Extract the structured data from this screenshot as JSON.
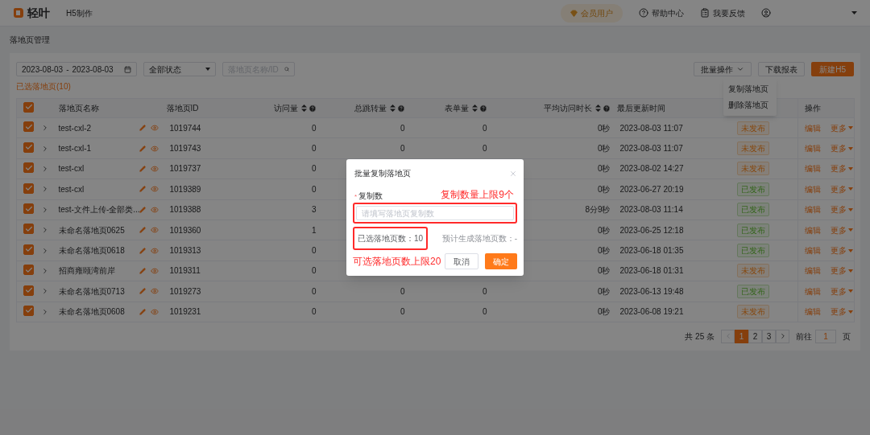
{
  "header": {
    "logo_text": "轻叶",
    "product": "H5制作",
    "member": "会员用户",
    "links": [
      {
        "kind": "help",
        "label": "帮助中心"
      },
      {
        "kind": "feedback",
        "label": "我要反馈"
      }
    ]
  },
  "breadcrumb": "落地页管理",
  "filters": {
    "date_start": "2023-08-03",
    "date_sep": "-",
    "date_end": "2023-08-03",
    "status": "全部状态",
    "search_placeholder": "落地页名称/ID"
  },
  "selected_text": "已选落地页(10)",
  "toolbar": {
    "batch": "批量操作",
    "download": "下载报表",
    "create": "新建H5",
    "batch_menu": [
      {
        "label": "复制落地页"
      },
      {
        "label": "删除落地页"
      }
    ]
  },
  "table": {
    "all_checked": true,
    "columns": [
      {
        "label": "落地页名称",
        "sortable": false,
        "help": false
      },
      {
        "label": "落地页ID",
        "sortable": false,
        "help": false
      },
      {
        "label": "访问量",
        "sortable": true,
        "help": true
      },
      {
        "label": "总跳转量",
        "sortable": true,
        "help": true
      },
      {
        "label": "表单量",
        "sortable": true,
        "help": true
      },
      {
        "label": "平均访问时长",
        "sortable": true,
        "help": true
      },
      {
        "label": "最后更新时间",
        "sortable": false,
        "help": false
      },
      {
        "label": "操作",
        "sortable": false,
        "help": false
      }
    ],
    "rows": [
      {
        "checked": true,
        "name": "test-cxl-2",
        "id": "1019744",
        "visits": "0",
        "jumps": "0",
        "forms": "0",
        "avg": "0秒",
        "updated": "2023-08-03 11:07",
        "status": "未发布",
        "published": false,
        "edit": "编辑",
        "more": "更多"
      },
      {
        "checked": true,
        "name": "test-cxl-1",
        "id": "1019743",
        "visits": "0",
        "jumps": "0",
        "forms": "0",
        "avg": "0秒",
        "updated": "2023-08-03 11:07",
        "status": "未发布",
        "published": false,
        "edit": "编辑",
        "more": "更多"
      },
      {
        "checked": true,
        "name": "test-cxl",
        "id": "1019737",
        "visits": "0",
        "avg": "0秒",
        "updated": "2023-08-02 14:27",
        "status": "未发布",
        "published": false,
        "edit": "编辑",
        "more": "更多"
      },
      {
        "checked": true,
        "name": "test-cxl",
        "id": "1019389",
        "visits": "0",
        "avg": "0秒",
        "updated": "2023-06-27 20:19",
        "status": "已发布",
        "published": true,
        "edit": "编辑",
        "more": "更多"
      },
      {
        "checked": true,
        "name": "test-文件上传-全部类...",
        "id": "1019388",
        "visits": "3",
        "avg": "8分9秒",
        "updated": "2023-08-03 11:14",
        "status": "已发布",
        "published": true,
        "edit": "编辑",
        "more": "更多"
      },
      {
        "checked": true,
        "name": "未命名落地页0625",
        "id": "1019360",
        "visits": "1",
        "avg": "0秒",
        "updated": "2023-06-25 12:18",
        "status": "已发布",
        "published": true,
        "edit": "编辑",
        "more": "更多"
      },
      {
        "checked": true,
        "name": "未命名落地页0618",
        "id": "1019313",
        "visits": "0",
        "avg": "0秒",
        "updated": "2023-06-18 01:35",
        "status": "已发布",
        "published": true,
        "edit": "编辑",
        "more": "更多"
      },
      {
        "checked": true,
        "name": "招商雍颐湾前岸",
        "id": "1019311",
        "visits": "0",
        "avg": "0秒",
        "updated": "2023-06-18 01:31",
        "status": "未发布",
        "published": false,
        "edit": "编辑",
        "more": "更多"
      },
      {
        "checked": true,
        "name": "未命名落地页0713",
        "id": "1019273",
        "visits": "0",
        "jumps": "0",
        "forms": "0",
        "avg": "0秒",
        "updated": "2023-06-13 19:48",
        "status": "已发布",
        "published": true,
        "edit": "编辑",
        "more": "更多"
      },
      {
        "checked": true,
        "name": "未命名落地页0608",
        "id": "1019231",
        "visits": "0",
        "jumps": "0",
        "forms": "0",
        "avg": "0秒",
        "updated": "2023-06-08 19:21",
        "status": "未发布",
        "published": false,
        "edit": "编辑",
        "more": "更多"
      }
    ]
  },
  "pagination": {
    "total": "共 25 条",
    "pages": [
      {
        "label": "1",
        "selected": true
      },
      {
        "label": "2",
        "selected": false
      },
      {
        "label": "3",
        "selected": false
      }
    ],
    "goto_label": "前往",
    "goto_value": "1",
    "suffix": "页"
  },
  "dialog": {
    "title": "批量复制落地页",
    "field_label": "复制数",
    "required_mark": "*",
    "placeholder": "请填写落地页复制数",
    "selected_count": "已选落地页数：10",
    "estimate": "预计生成落地页数：-",
    "cancel": "取消",
    "confirm": "确定",
    "field_highlighted": true,
    "count_highlighted": true,
    "annotations": [
      {
        "text": "复制数量上限9个"
      },
      {
        "text": "可选落地页数上限20"
      }
    ]
  }
}
